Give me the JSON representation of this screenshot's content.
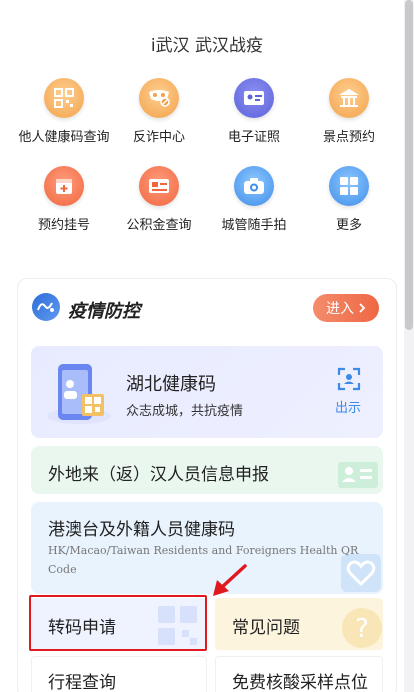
{
  "app": {
    "title": "i武汉 武汉战疫"
  },
  "services_row1": [
    {
      "label": "他人健康码查询",
      "icon": "qr-code-icon"
    },
    {
      "label": "反诈中心",
      "icon": "anti-fraud-mask-icon"
    },
    {
      "label": "电子证照",
      "icon": "id-card-icon"
    },
    {
      "label": "景点预约",
      "icon": "pavilion-icon"
    }
  ],
  "services_row2": [
    {
      "label": "预约挂号",
      "icon": "hospital-calendar-icon"
    },
    {
      "label": "公积金查询",
      "icon": "fund-card-icon"
    },
    {
      "label": "城管随手拍",
      "icon": "camera-icon"
    },
    {
      "label": "更多",
      "icon": "grid-more-icon"
    }
  ],
  "epidemic": {
    "title": "疫情防控",
    "enter_label": "进入",
    "health_code": {
      "title": "湖北健康码",
      "subtitle": "众志成城，共抗疫情",
      "show_label": "出示"
    },
    "report": {
      "label": "外地来（返）汉人员信息申报"
    },
    "foreign": {
      "title": "港澳台及外籍人员健康码",
      "subtitle": "HK/Macao/Taiwan Residents and Foreigners Health QR Code"
    },
    "tiles": [
      {
        "label": "转码申请"
      },
      {
        "label": "常见问题"
      },
      {
        "label": "行程查询"
      },
      {
        "label": "免费核酸采样点位"
      }
    ]
  },
  "colors": {
    "accent": "#ef6744",
    "blue": "#3d8ae8",
    "highlight": "#e0191f"
  }
}
